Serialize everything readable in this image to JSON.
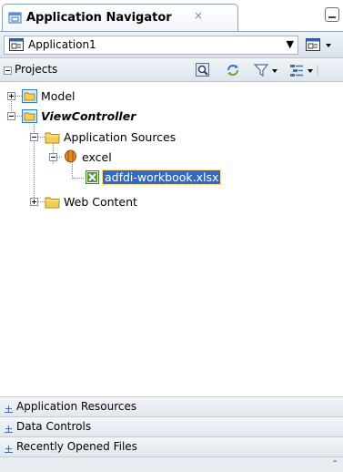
{
  "window": {
    "tab_title": "Application Navigator",
    "tab_close_glyph": "×",
    "minimize_label": ""
  },
  "app_selector": {
    "selected": "Application1",
    "arrow_glyph": "▼"
  },
  "projects": {
    "label": "Projects",
    "toolbar_icons": [
      "search-icon",
      "refresh-icon",
      "filter-icon",
      "view-options-icon"
    ]
  },
  "tree": {
    "model": "Model",
    "view_controller": "ViewController",
    "application_sources": "Application Sources",
    "excel": "excel",
    "workbook": "adfdi-workbook.xlsx",
    "web_content": "Web Content"
  },
  "accordion": {
    "application_resources": "Application Resources",
    "data_controls": "Data Controls",
    "recently_opened": "Recently Opened Files"
  },
  "colors": {
    "selection": "#316ac5",
    "folder": "#f3cf5a",
    "project": "#2f7bd0"
  }
}
